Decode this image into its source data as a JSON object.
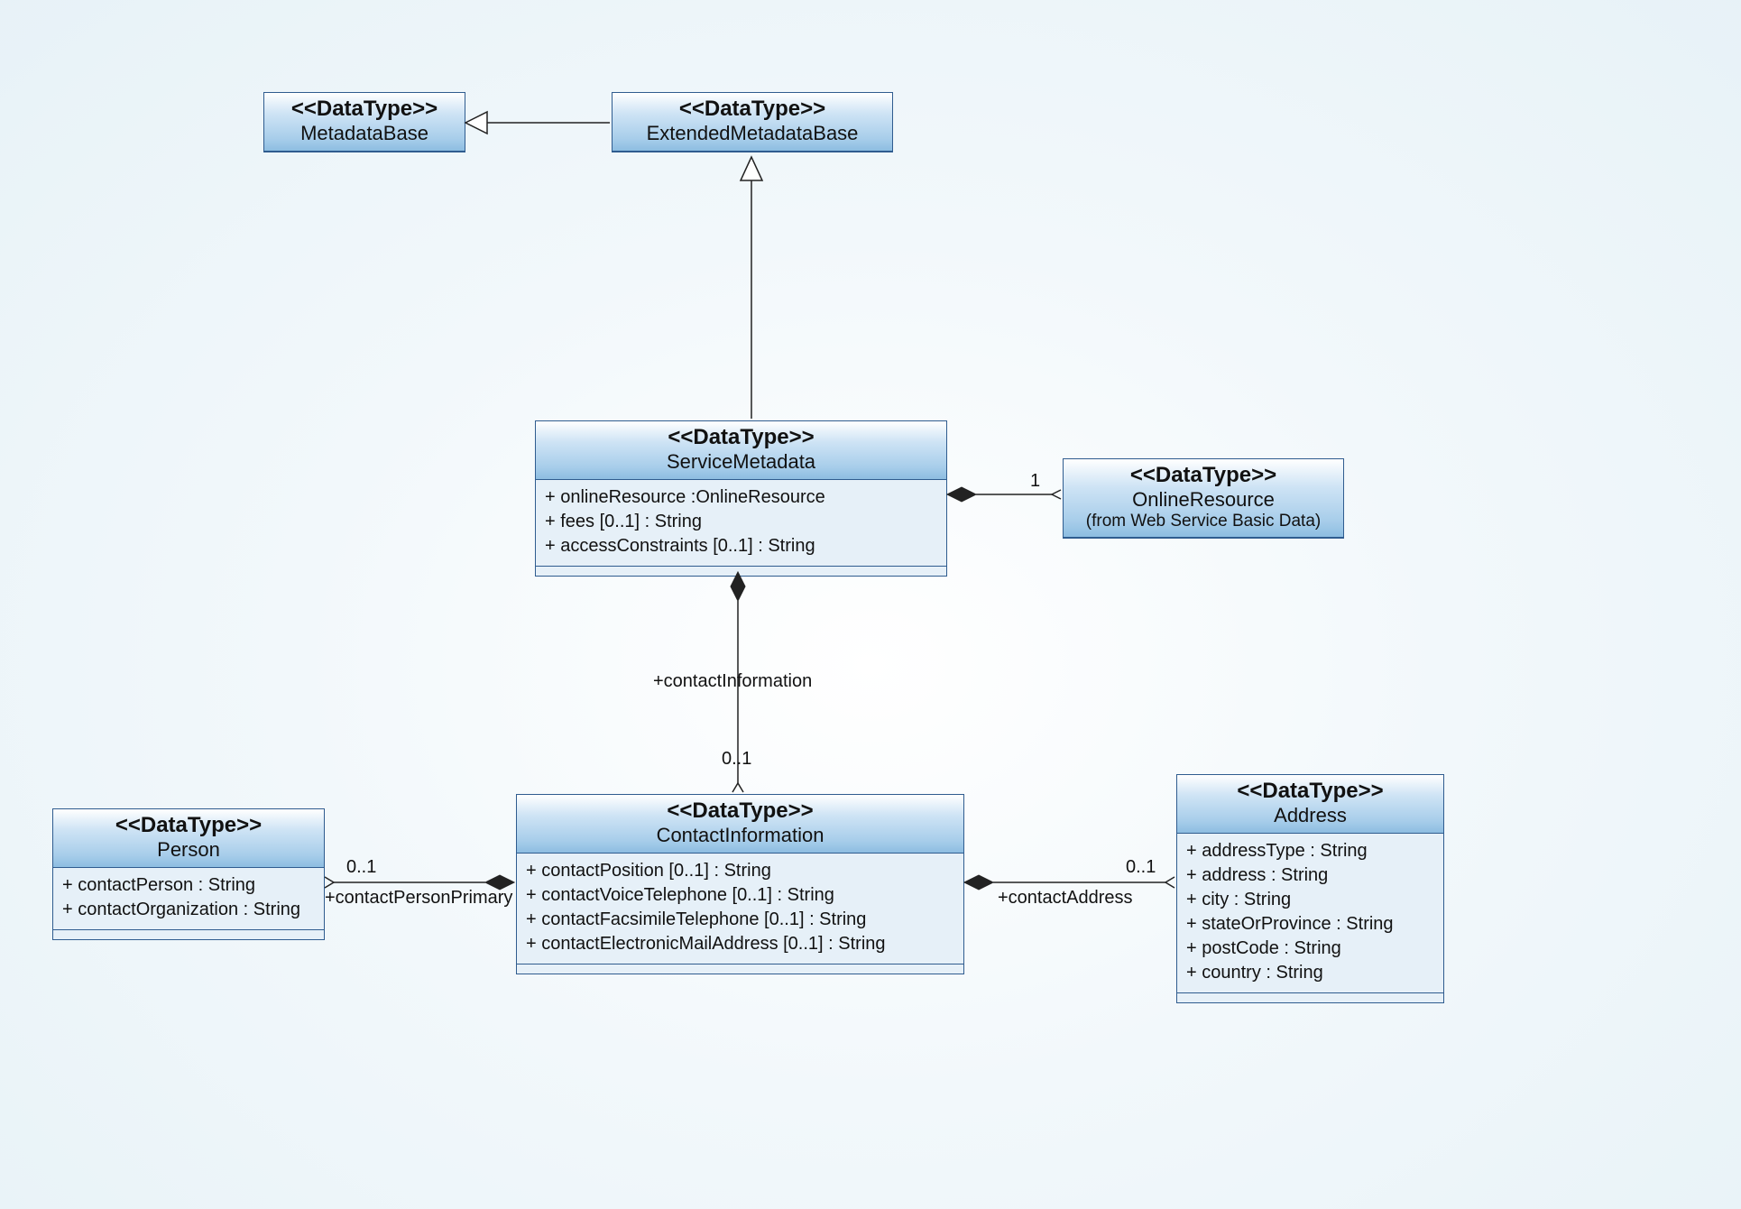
{
  "stereotype": "<<DataType>>",
  "classes": {
    "metadataBase": {
      "name": "MetadataBase"
    },
    "extendedMetadataBase": {
      "name": "ExtendedMetadataBase"
    },
    "serviceMetadata": {
      "name": "ServiceMetadata",
      "attrs": [
        "+ onlineResource :OnlineResource",
        "+ fees [0..1] : String",
        "+ accessConstraints [0..1] : String"
      ]
    },
    "onlineResource": {
      "name": "OnlineResource",
      "from": "(from Web Service Basic Data)"
    },
    "contactInformation": {
      "name": "ContactInformation",
      "attrs": [
        "+ contactPosition [0..1] : String",
        "+ contactVoiceTelephone [0..1] : String",
        "+ contactFacsimileTelephone [0..1] : String",
        "+ contactElectronicMailAddress [0..1] : String"
      ]
    },
    "person": {
      "name": "Person",
      "attrs": [
        "+ contactPerson : String",
        "+ contactOrganization : String"
      ]
    },
    "address": {
      "name": "Address",
      "attrs": [
        "+ addressType : String",
        "+ address : String",
        "+ city : String",
        "+ stateOrProvince : String",
        "+ postCode : String",
        "+ country : String"
      ]
    }
  },
  "assoc": {
    "onlineResourceMult": "1",
    "contactInfoRole": "+contactInformation",
    "contactInfoMult": "0..1",
    "personRole": "+contactPersonPrimary",
    "personMult": "0..1",
    "addressRole": "+contactAddress",
    "addressMult": "0..1"
  }
}
